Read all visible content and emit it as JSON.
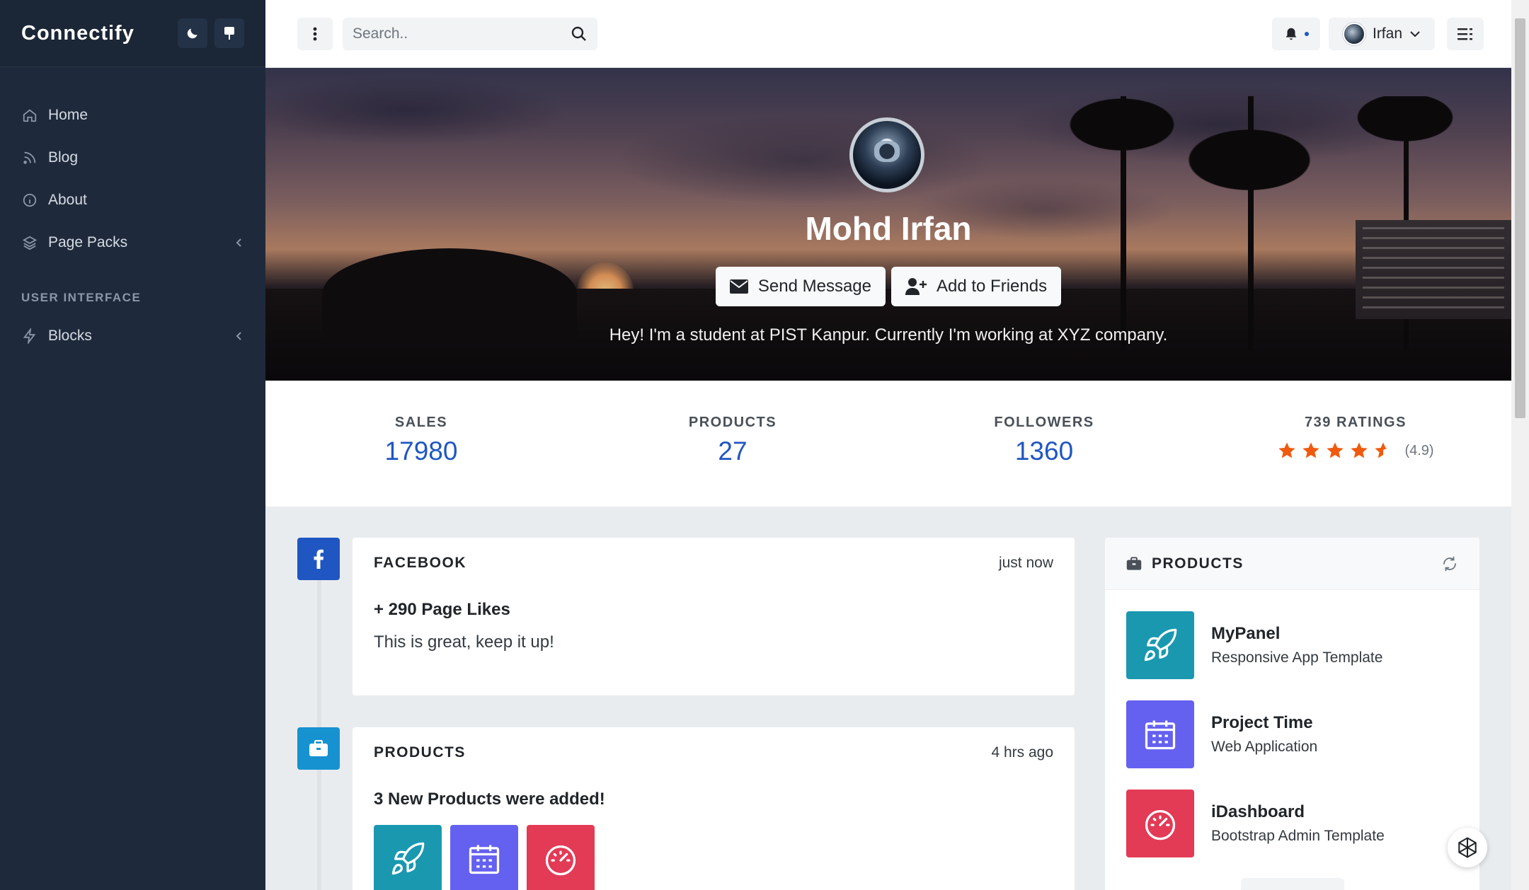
{
  "sidebar": {
    "brand": "Connectify",
    "items": [
      {
        "label": "Home",
        "icon": "home-icon"
      },
      {
        "label": "Blog",
        "icon": "rss-icon"
      },
      {
        "label": "About",
        "icon": "info-icon"
      },
      {
        "label": "Page Packs",
        "icon": "layers-icon"
      }
    ],
    "section_header": "USER INTERFACE",
    "section_items": [
      {
        "label": "Blocks",
        "icon": "zap-icon"
      }
    ]
  },
  "topbar": {
    "search_placeholder": "Search..",
    "user_name": "Irfan"
  },
  "profile": {
    "name": "Mohd Irfan",
    "send_message_label": "Send Message",
    "add_friend_label": "Add to Friends",
    "bio": "Hey! I'm a student at PIST Kanpur. Currently I'm working at XYZ company."
  },
  "stats": {
    "sales_label": "SALES",
    "sales_value": "17980",
    "products_label": "PRODUCTS",
    "products_value": "27",
    "followers_label": "FOLLOWERS",
    "followers_value": "1360",
    "ratings_label": "739 RATINGS",
    "rating_value": "(4.9)",
    "stars": 4.5
  },
  "timeline": [
    {
      "title": "FACEBOOK",
      "time": "just now",
      "headline": "+ 290 Page Likes",
      "text": "This is great, keep it up!"
    },
    {
      "title": "PRODUCTS",
      "time": "4 hrs ago",
      "headline": "3 New Products were added!"
    }
  ],
  "products_card": {
    "title": "PRODUCTS",
    "items": [
      {
        "name": "MyPanel",
        "desc": "Responsive App Template",
        "color": "#1a98b0",
        "icon": "rocket-icon"
      },
      {
        "name": "Project Time",
        "desc": "Web Application",
        "color": "#6461f0",
        "icon": "calendar-icon"
      },
      {
        "name": "iDashboard",
        "desc": "Bootstrap Admin Template",
        "color": "#e33a56",
        "icon": "speedometer-icon"
      }
    ]
  },
  "colors": {
    "sidebar_bg": "#1e2a3b",
    "accent": "#1f56c2",
    "facebook": "#1f56c2",
    "products_icon": "#1792d0",
    "star": "#f05a0e"
  }
}
